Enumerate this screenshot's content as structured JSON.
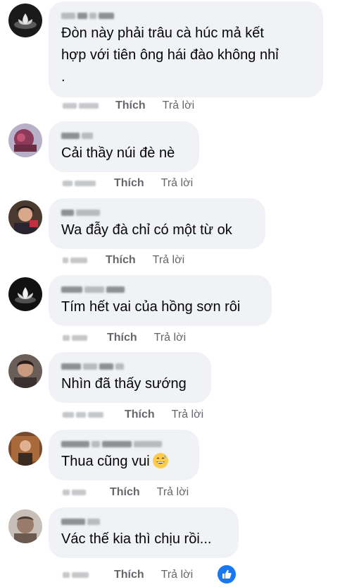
{
  "comments": [
    {
      "text": "Đòn này phải trâu cà húc mả kết\nhợp với tiên ông hái đào không nhỉ\n.",
      "like": "Thích",
      "reply": "Trả lời"
    },
    {
      "text": "Cải thầy núi đè nè",
      "like": "Thích",
      "reply": "Trả lời"
    },
    {
      "text": "Wa đẫy đà chỉ có một từ ok",
      "like": "Thích",
      "reply": "Trả lời"
    },
    {
      "text": "Tím hết vai của hồng sơn rôi",
      "like": "Thích",
      "reply": "Trả lời"
    },
    {
      "text": "Nhìn đã thấy sướng",
      "like": "Thích",
      "reply": "Trả lời"
    },
    {
      "text": "Thua cũng vui",
      "emoji": "grinning-sweat-emoji",
      "like": "Thích",
      "reply": "Trả lời"
    },
    {
      "text": "Vác thế kia thì chịu rồi...",
      "like": "Thích",
      "reply": "Trả lời",
      "reaction": "like-reaction-icon"
    }
  ],
  "colors": {
    "bubble": "#f0f2f5",
    "meta_text": "#65676b",
    "like_blue": "#1877f2"
  }
}
